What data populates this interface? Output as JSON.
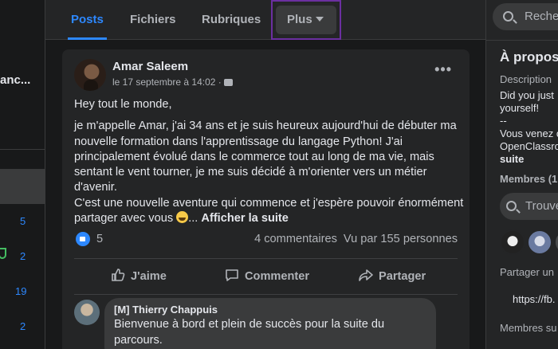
{
  "sidebar": {
    "group_name_truncated": "anc...",
    "counts": [
      "5",
      "2",
      "19",
      "2"
    ]
  },
  "tabs": [
    {
      "label": "Posts",
      "active": true
    },
    {
      "label": "Fichiers",
      "active": false
    },
    {
      "label": "Rubriques",
      "active": false
    },
    {
      "label": "Plus",
      "active": false
    }
  ],
  "search": {
    "placeholder": "Recherc"
  },
  "post": {
    "author": "Amar Saleem",
    "date": "le 17 septembre à 14:02 ·",
    "greeting": "Hey tout le monde,",
    "paragraph": "je m'appelle Amar, j'ai 34 ans et je suis heureux aujourd'hui de débuter ma nouvelle formation dans l'apprentissage du langage Python! J'ai principalement évolué dans le commerce tout au long de ma vie, mais sentant le vent tourner, je me suis décidé à m'orienter vers un métier d'avenir.",
    "paragraph2": "C'est une nouvelle aventure qui commence et j'espère pouvoir énormément partager avec vous",
    "ellipsis": "...",
    "see_more": "Afficher la suite",
    "likes": "5",
    "comments": "4 commentaires",
    "views": "Vu par 155 personnes",
    "actions": {
      "like": "J'aime",
      "comment": "Commenter",
      "share": "Partager"
    }
  },
  "comment": {
    "author": "[M] Thierry Chappuis",
    "text": "Bienvenue à bord et plein de succès pour la suite du parcours."
  },
  "about": {
    "title": "À propos",
    "description_label": "Description",
    "description_lines": [
      "Did you just",
      "yourself!",
      "--",
      "Vous venez c",
      "OpenClassro"
    ],
    "more": "suite",
    "members_label": "Membres (1",
    "members_search": "Trouve",
    "share_label": "Partager un",
    "link": "https://fb.",
    "members_section": "Membres su"
  },
  "colors": {
    "accent": "#2d88ff",
    "background": "#18191a",
    "card": "#242526"
  }
}
